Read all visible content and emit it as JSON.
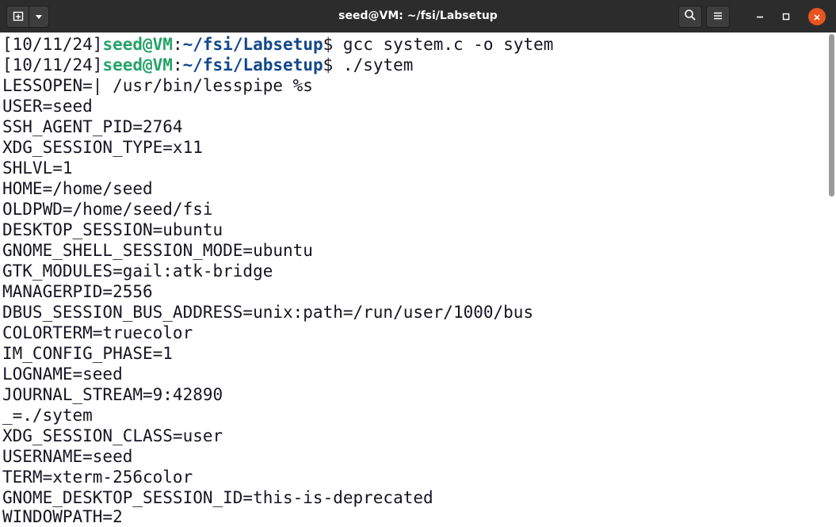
{
  "window": {
    "title": "seed@VM: ~/fsi/Labsetup",
    "icons": {
      "new_tab": "new-tab-icon",
      "menu": "chevron-down-icon",
      "search": "search-icon",
      "hamburger": "hamburger-menu-icon",
      "minimize": "minimize-icon",
      "maximize": "maximize-icon",
      "close": "close-icon"
    },
    "close_color": "#e95420"
  },
  "colors": {
    "prompt_user_host": "#26a269",
    "prompt_path": "#12488b",
    "text": "#171421",
    "titlebar": "#2c2c2c"
  },
  "terminal": {
    "prompts": [
      {
        "timestamp": "[10/11/24]",
        "user_host": "seed@VM",
        "separator": ":",
        "path": "~/fsi/Labsetup",
        "dollar": "$",
        "command": " gcc system.c -o sytem"
      },
      {
        "timestamp": "[10/11/24]",
        "user_host": "seed@VM",
        "separator": ":",
        "path": "~/fsi/Labsetup",
        "dollar": "$",
        "command": " ./sytem"
      }
    ],
    "output": [
      "LESSOPEN=| /usr/bin/lesspipe %s",
      "USER=seed",
      "SSH_AGENT_PID=2764",
      "XDG_SESSION_TYPE=x11",
      "SHLVL=1",
      "HOME=/home/seed",
      "OLDPWD=/home/seed/fsi",
      "DESKTOP_SESSION=ubuntu",
      "GNOME_SHELL_SESSION_MODE=ubuntu",
      "GTK_MODULES=gail:atk-bridge",
      "MANAGERPID=2556",
      "DBUS_SESSION_BUS_ADDRESS=unix:path=/run/user/1000/bus",
      "COLORTERM=truecolor",
      "IM_CONFIG_PHASE=1",
      "LOGNAME=seed",
      "JOURNAL_STREAM=9:42890",
      "_=./sytem",
      "XDG_SESSION_CLASS=user",
      "USERNAME=seed",
      "TERM=xterm-256color",
      "GNOME_DESKTOP_SESSION_ID=this-is-deprecated",
      "WINDOWPATH=2"
    ]
  }
}
